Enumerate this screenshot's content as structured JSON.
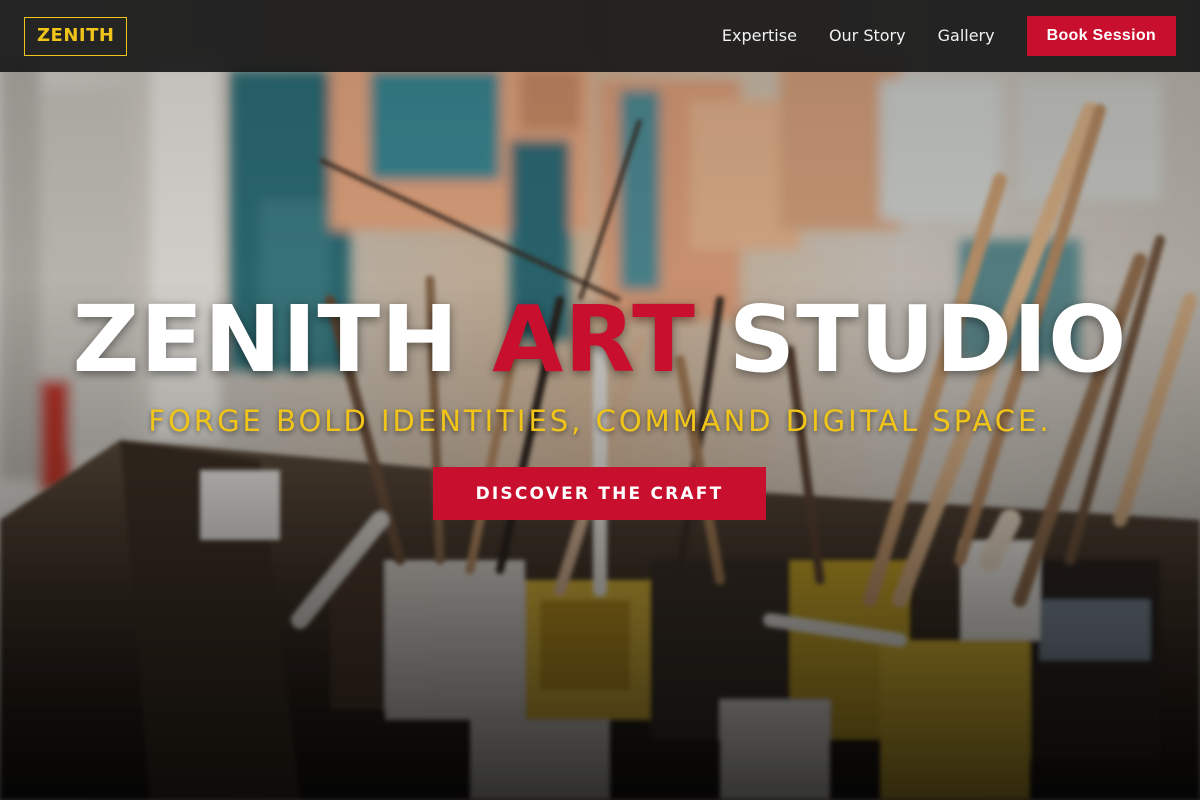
{
  "brand": {
    "logo_text": "ZENITH"
  },
  "nav": {
    "links": [
      {
        "label": "Expertise"
      },
      {
        "label": "Our Story"
      },
      {
        "label": "Gallery"
      }
    ],
    "cta_label": "Book Session"
  },
  "hero": {
    "title_part1": "ZENITH ",
    "title_accent": "ART",
    "title_part2": " STUDIO",
    "subtitle": "FORGE BOLD IDENTITIES, COMMAND DIGITAL SPACE.",
    "cta_label": "DISCOVER THE CRAFT",
    "background_image": "art-studio-paint-brushes-photo"
  },
  "colors": {
    "accent_red": "#c8102e",
    "accent_gold": "#f0c419",
    "nav_background": "#181818",
    "text_white": "#ffffff"
  }
}
